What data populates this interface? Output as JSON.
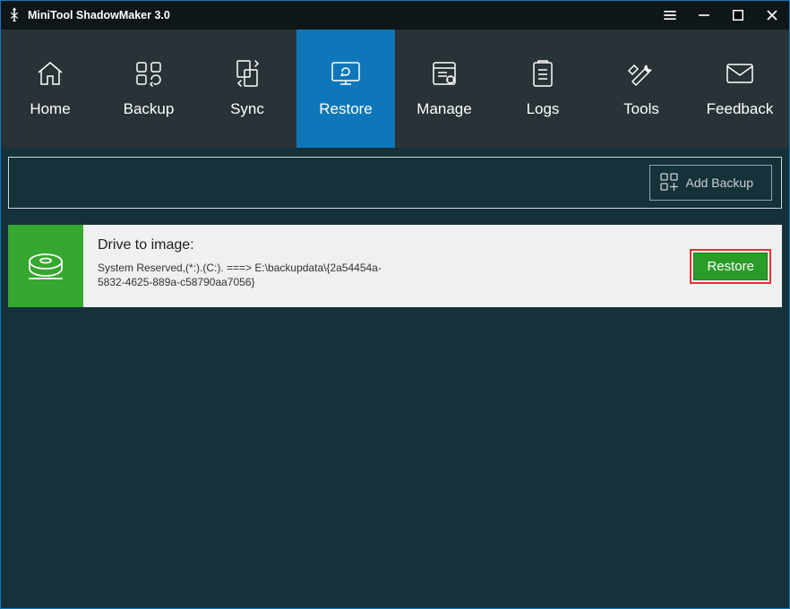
{
  "titlebar": {
    "title": "MiniTool ShadowMaker 3.0"
  },
  "nav": {
    "items": [
      {
        "label": "Home"
      },
      {
        "label": "Backup"
      },
      {
        "label": "Sync"
      },
      {
        "label": "Restore"
      },
      {
        "label": "Manage"
      },
      {
        "label": "Logs"
      },
      {
        "label": "Tools"
      },
      {
        "label": "Feedback"
      }
    ]
  },
  "subbar": {
    "add_backup_label": "Add Backup"
  },
  "backup": {
    "title": "Drive to image:",
    "detail": "System Reserved,(*:).(C:). ===> E:\\backupdata\\{2a54454a-5832-4625-889a-c58790aa7056}",
    "restore_label": "Restore"
  }
}
